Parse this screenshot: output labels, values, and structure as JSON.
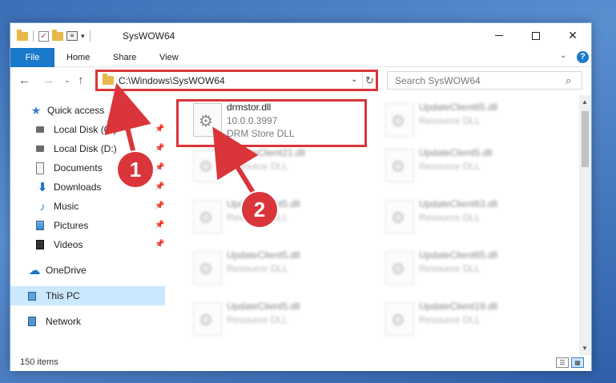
{
  "window": {
    "title": "SysWOW64"
  },
  "ribbon": {
    "tabs": [
      "File",
      "Home",
      "Share",
      "View"
    ]
  },
  "nav": {
    "address": "C:\\Windows\\SysWOW64",
    "search_placeholder": "Search SysWOW64"
  },
  "sidebar": {
    "items": [
      {
        "label": "Quick access",
        "icon": "star-icon"
      },
      {
        "label": "Local Disk (C:)",
        "icon": "disk-icon",
        "pinned": true
      },
      {
        "label": "Local Disk (D:)",
        "icon": "disk-icon",
        "pinned": true
      },
      {
        "label": "Documents",
        "icon": "documents-icon",
        "pinned": true
      },
      {
        "label": "Downloads",
        "icon": "downloads-icon",
        "pinned": true
      },
      {
        "label": "Music",
        "icon": "music-icon",
        "pinned": true
      },
      {
        "label": "Pictures",
        "icon": "pictures-icon",
        "pinned": true
      },
      {
        "label": "Videos",
        "icon": "videos-icon",
        "pinned": true
      },
      {
        "label": "OneDrive",
        "icon": "onedrive-icon"
      },
      {
        "label": "This PC",
        "icon": "pc-icon",
        "selected": true
      },
      {
        "label": "Network",
        "icon": "network-icon"
      }
    ]
  },
  "files": {
    "highlighted": {
      "name": "drmstor.dll",
      "version": "10.0.0.3997",
      "description": "DRM Store DLL"
    },
    "left": [
      {
        "name": "UpdateClient21.dll",
        "description": "Resource DLL"
      },
      {
        "name": "UpdateClient5.dll",
        "description": "Resource DLL"
      },
      {
        "name": "UpdateClient5.dll",
        "description": "Resource DLL"
      },
      {
        "name": "UpdateClient5.dll",
        "description": "Resource DLL"
      }
    ],
    "right": [
      {
        "name": "UpdateClient65.dll",
        "description": "Resource DLL"
      },
      {
        "name": "UpdateClient5.dll",
        "description": "Resource DLL"
      },
      {
        "name": "UpdateClient63.dll",
        "description": "Resource DLL"
      },
      {
        "name": "UpdateClient65.dll",
        "description": "Resource DLL"
      },
      {
        "name": "UpdateClient19.dll",
        "description": "Resource DLL"
      }
    ]
  },
  "status": {
    "items": "150 items"
  },
  "callouts": [
    "1",
    "2"
  ],
  "colors": {
    "accent": "#1979ca",
    "highlight": "#d9353a",
    "selected": "#cce8ff"
  }
}
